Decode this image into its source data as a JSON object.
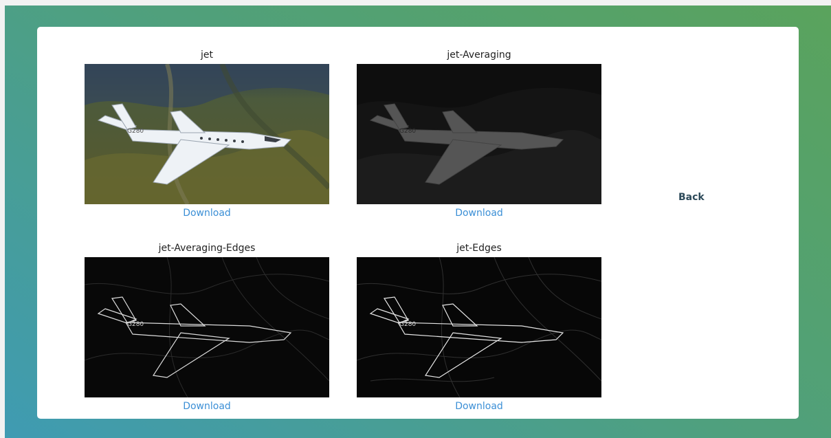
{
  "images": [
    {
      "title": "jet",
      "download_label": "Download",
      "icon": "jet-photo"
    },
    {
      "title": "jet-Averaging",
      "download_label": "Download",
      "icon": "jet-photo-averaged"
    },
    {
      "title": "jet-Averaging-Edges",
      "download_label": "Download",
      "icon": "jet-photo-averaged-edges"
    },
    {
      "title": "jet-Edges",
      "download_label": "Download",
      "icon": "jet-photo-edges"
    }
  ],
  "back_label": "Back",
  "colors": {
    "link": "#3b8fd6",
    "back": "#2d4a5a",
    "card": "#ffffff"
  }
}
